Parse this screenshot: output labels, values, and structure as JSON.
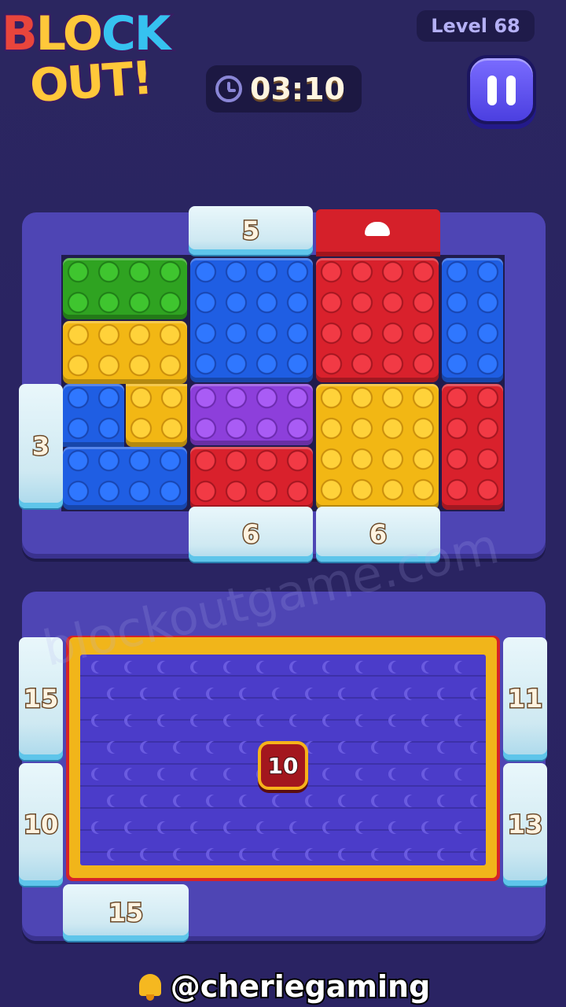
{
  "header": {
    "logo_line1_parts": [
      "B",
      "L",
      "O",
      "C",
      "K"
    ],
    "logo_line2": "OUT!",
    "level_label": "Level 68",
    "timer": "03:10"
  },
  "upper_board": {
    "gates": [
      {
        "side": "top",
        "count": "5"
      },
      {
        "side": "left",
        "count": "3"
      },
      {
        "side": "bottom",
        "count": "6"
      },
      {
        "side": "bottom",
        "count": "6"
      }
    ],
    "blocks": [
      {
        "color": "green",
        "studs": "4x2"
      },
      {
        "color": "yellow",
        "studs": "L-shape"
      },
      {
        "color": "blue",
        "studs": "L-shape"
      },
      {
        "color": "blue",
        "studs": "4x4"
      },
      {
        "color": "purple",
        "studs": "4x2"
      },
      {
        "color": "red",
        "studs": "4x2"
      },
      {
        "color": "red",
        "studs": "4x4"
      },
      {
        "color": "yellow",
        "studs": "4x4"
      },
      {
        "color": "blue",
        "studs": "2x4"
      },
      {
        "color": "red",
        "studs": "2x4"
      }
    ],
    "exit_gate_color": "red"
  },
  "lower_board": {
    "center_badge": "10",
    "gates_left": [
      "15",
      "10"
    ],
    "gates_right": [
      "11",
      "13"
    ],
    "gate_bottom": "15"
  },
  "watermark": "blockoutgame.com",
  "footer": {
    "handle": "@cheriegaming",
    "icon": "bell-icon"
  },
  "colors": {
    "background": "#2a2462",
    "board_frame": "#4e45b4",
    "green": "#2fa321",
    "blue": "#1f5ee3",
    "red": "#d9212c",
    "yellow": "#f2b714",
    "purple": "#8d3fdb"
  }
}
